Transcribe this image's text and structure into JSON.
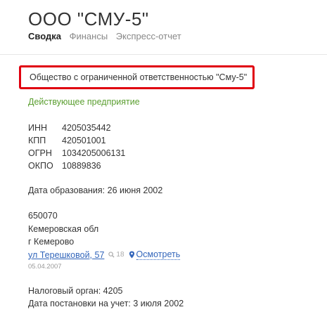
{
  "header": {
    "title": "ООО \"СМУ-5\"",
    "tabs": [
      {
        "label": "Сводка"
      },
      {
        "label": "Финансы"
      },
      {
        "label": "Экспресс-отчет"
      }
    ]
  },
  "company": {
    "full_name": "Общество с ограниченной ответственностью \"Сму-5\"",
    "status": "Действующее предприятие"
  },
  "codes": [
    {
      "label": "ИНН",
      "value": "4205035442"
    },
    {
      "label": "КПП",
      "value": "420501001"
    },
    {
      "label": "ОГРН",
      "value": "1034205006131"
    },
    {
      "label": "ОКПО",
      "value": "10889836"
    }
  ],
  "registration": {
    "text": "Дата образования: 26 июня 2002"
  },
  "address": {
    "postcode": "650070",
    "region": "Кемеровская обл",
    "city": "г Кемерово",
    "street": "ул Терешковой, 57",
    "search_count": "18",
    "map_label": "Осмотреть",
    "date": "05.04.2007"
  },
  "tax": {
    "authority": "Налоговый орган: 4205",
    "registered": "Дата постановки на учет: 3 июля 2002"
  },
  "colors": {
    "highlight_border": "#e0000f",
    "status_green": "#5a9e2f",
    "link_blue": "#3366bb"
  },
  "icons": {
    "search": "search-icon",
    "map": "map-pin-icon"
  }
}
